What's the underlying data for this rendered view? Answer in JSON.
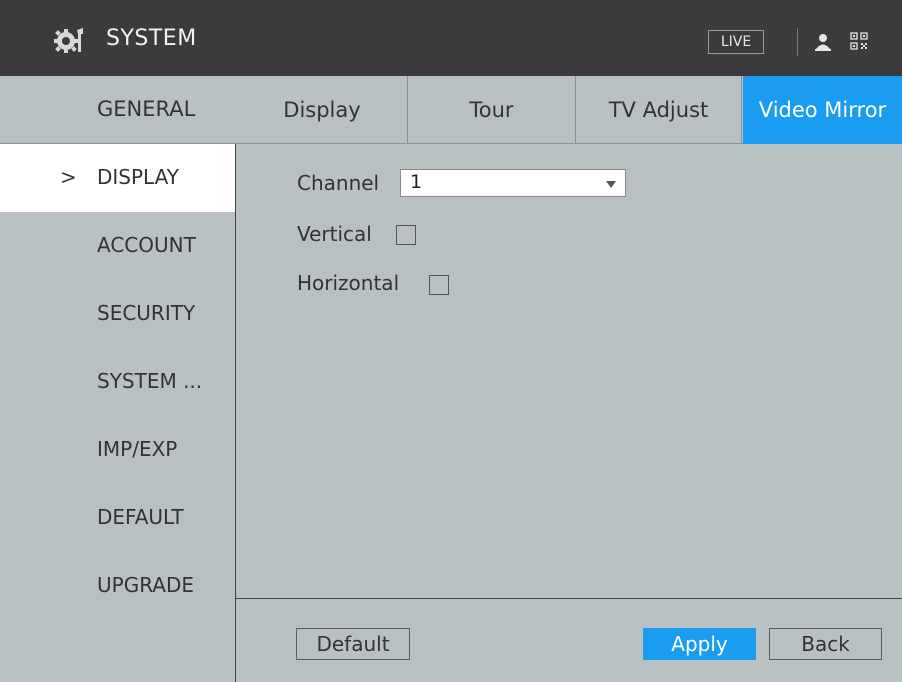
{
  "header": {
    "title": "SYSTEM",
    "live_label": "LIVE",
    "icons": [
      "gear-icon",
      "user-icon",
      "qr-code-icon"
    ]
  },
  "tabs": {
    "section_label": "GENERAL",
    "items": [
      {
        "label": "Display",
        "active": false
      },
      {
        "label": "Tour",
        "active": false
      },
      {
        "label": "TV Adjust",
        "active": false
      },
      {
        "label": "Video Mirror",
        "active": true
      }
    ]
  },
  "sidebar": {
    "items": [
      {
        "label": "DISPLAY",
        "active": true
      },
      {
        "label": "ACCOUNT",
        "active": false
      },
      {
        "label": "SECURITY",
        "active": false
      },
      {
        "label": "SYSTEM ...",
        "active": false
      },
      {
        "label": "IMP/EXP",
        "active": false
      },
      {
        "label": "DEFAULT",
        "active": false
      },
      {
        "label": "UPGRADE",
        "active": false
      }
    ],
    "active_indicator": ">"
  },
  "form": {
    "channel_label": "Channel",
    "channel_value": "1",
    "vertical_label": "Vertical",
    "vertical_checked": false,
    "horizontal_label": "Horizontal",
    "horizontal_checked": false
  },
  "buttons": {
    "default_label": "Default",
    "apply_label": "Apply",
    "back_label": "Back"
  },
  "colors": {
    "accent": "#1a9cf0",
    "titlebar": "#3b3b3d",
    "panel": "#b9c0c2"
  }
}
